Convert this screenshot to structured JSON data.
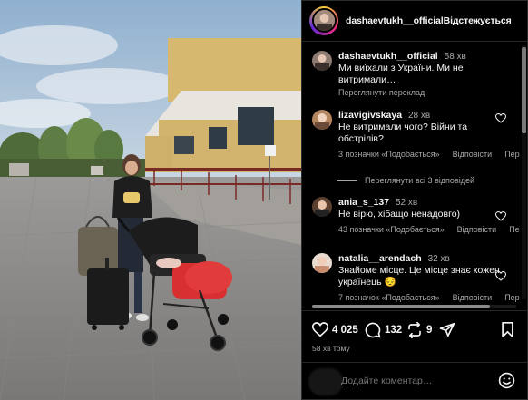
{
  "post": {
    "author": "dashaevtukh__official",
    "follow_label": "Відстежується"
  },
  "comments": [
    {
      "user": "dashaevtukh__official",
      "time": "58 хв",
      "text": "Ми виїхали з України. Ми не витримали…",
      "translate": "Переглянути переклад"
    },
    {
      "user": "lizavigivskaya",
      "time": "28 хв",
      "text": "Не витримали чого? Війни та обстрілів?",
      "likes": "3 позначки «Подобається»",
      "reply": "Відповісти",
      "extra": "Пере",
      "view_replies": "Переглянути всі 3 відповідей"
    },
    {
      "user": "ania_s_137",
      "time": "52 хв",
      "text": "Не вірю, хібащо ненадовго)",
      "likes": "43 позначки «Подобається»",
      "reply": "Відповісти",
      "extra": "Пере"
    },
    {
      "user": "natalia__arendach",
      "time": "32 хв",
      "text": "Знайоме місце. Це місце знає кожен українець 😔",
      "likes": "7 позначок «Подобається»",
      "reply": "Відповісти",
      "extra": "Пере"
    }
  ],
  "actions": {
    "likes": "4 025",
    "comments": "132",
    "reposts": "9"
  },
  "posted_ago": "58 хв тому",
  "add_comment_placeholder": "Додайте коментар…",
  "icons": {
    "like": "heart-icon",
    "comment": "comment-icon",
    "repost": "repost-icon",
    "share": "share-icon",
    "save": "bookmark-icon",
    "emoji": "emoji-icon"
  }
}
